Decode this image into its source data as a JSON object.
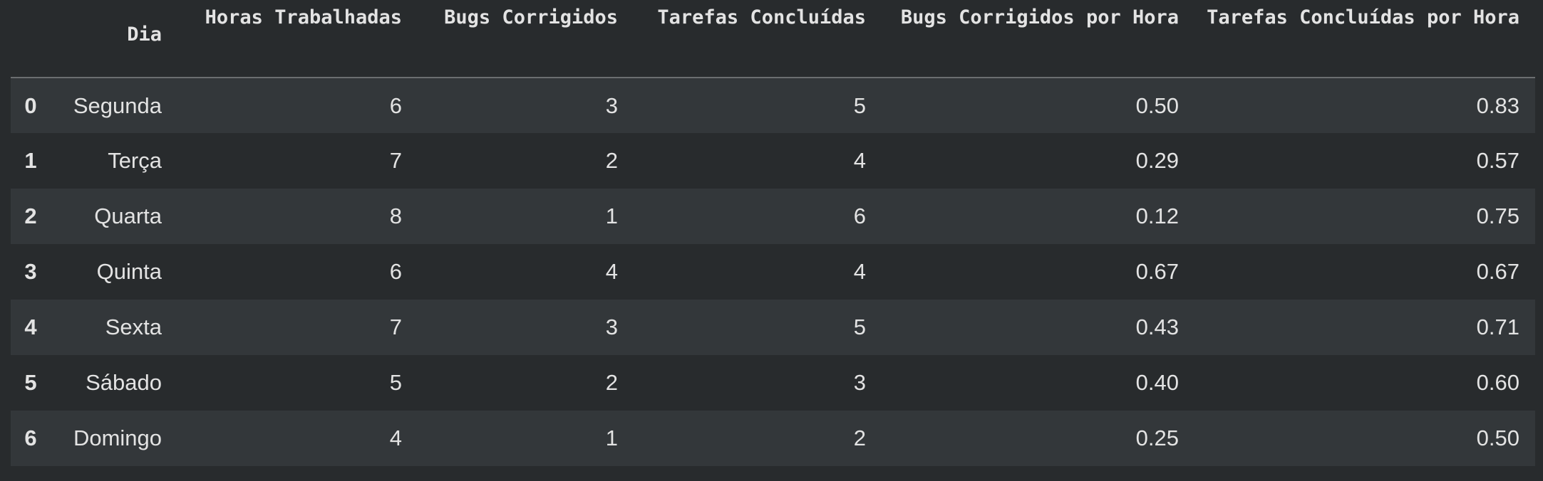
{
  "table": {
    "columns": {
      "index": "",
      "dia": "Dia",
      "horas": "Horas Trabalhadas",
      "bugs": "Bugs Corrigidos",
      "tarefas": "Tarefas Concluídas",
      "bugs_hora": "Bugs Corrigidos por Hora",
      "tarefas_hora": "Tarefas Concluídas por Hora"
    },
    "rows": [
      {
        "index": "0",
        "dia": "Segunda",
        "horas": "6",
        "bugs": "3",
        "tarefas": "5",
        "bugs_hora": "0.50",
        "tarefas_hora": "0.83"
      },
      {
        "index": "1",
        "dia": "Terça",
        "horas": "7",
        "bugs": "2",
        "tarefas": "4",
        "bugs_hora": "0.29",
        "tarefas_hora": "0.57"
      },
      {
        "index": "2",
        "dia": "Quarta",
        "horas": "8",
        "bugs": "1",
        "tarefas": "6",
        "bugs_hora": "0.12",
        "tarefas_hora": "0.75"
      },
      {
        "index": "3",
        "dia": "Quinta",
        "horas": "6",
        "bugs": "4",
        "tarefas": "4",
        "bugs_hora": "0.67",
        "tarefas_hora": "0.67"
      },
      {
        "index": "4",
        "dia": "Sexta",
        "horas": "7",
        "bugs": "3",
        "tarefas": "5",
        "bugs_hora": "0.43",
        "tarefas_hora": "0.71"
      },
      {
        "index": "5",
        "dia": "Sábado",
        "horas": "5",
        "bugs": "2",
        "tarefas": "3",
        "bugs_hora": "0.40",
        "tarefas_hora": "0.60"
      },
      {
        "index": "6",
        "dia": "Domingo",
        "horas": "4",
        "bugs": "1",
        "tarefas": "2",
        "bugs_hora": "0.25",
        "tarefas_hora": "0.50"
      }
    ]
  },
  "colors": {
    "background": "#282b2d",
    "row_stripe": "#33373a",
    "text": "#e3e3e3",
    "header_rule": "#6b6e70"
  }
}
